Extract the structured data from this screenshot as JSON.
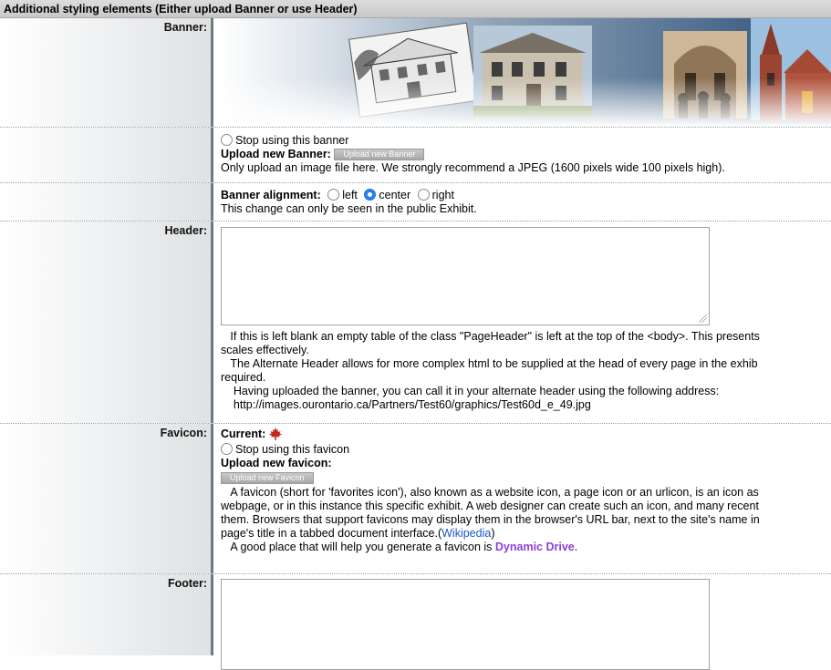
{
  "section_title": "Additional styling elements (Either upload Banner or use Header)",
  "banner": {
    "label": "Banner:",
    "stop_label": "Stop using this banner",
    "upload_label": "Upload new Banner:",
    "upload_button": "Upload new Banner",
    "upload_note": "Only upload an image file here. We strongly recommend a JPEG (1600 pixels wide 100 pixels high).",
    "alignment_label": "Banner alignment:",
    "align_options": [
      "left",
      "center",
      "right"
    ],
    "align_selected": "center",
    "alignment_note": "This change can only be seen in the public Exhibit."
  },
  "header": {
    "label": "Header:",
    "value": "",
    "help_1a": "If this is left blank an empty table of the class \"PageHeader\" is left at the top of the <body>. This presents",
    "help_1b": "scales effectively.",
    "help_2a": "The Alternate Header allows for more complex html to be supplied at the head of every page in the exhib",
    "help_2b": "required.",
    "help_3": "Having uploaded the banner, you can call it in your alternate header using the following address:",
    "help_url": "http://images.ourontario.ca/Partners/Test60/graphics/Test60d_e_49.jpg"
  },
  "favicon": {
    "label": "Favicon:",
    "current_label": "Current:",
    "stop_label": "Stop using this favicon",
    "upload_label": "Upload new favicon:",
    "upload_button": "Upload new Favicon",
    "desc_1": "A favicon (short for 'favorites icon'), also known as a website icon, a page icon or an urlicon, is an icon as",
    "desc_2": "webpage, or in this instance this specific exhibit. A web designer can create such an icon, and many recent",
    "desc_3": "them. Browsers that support favicons may display them in the browser's URL bar, next to the site's name in",
    "desc_4": "page's title in a tabbed document interface.(",
    "wikipedia_link": "Wikipedia",
    "desc_4_end": ")",
    "tip_prefix": "A good place that will help you generate a favicon is ",
    "tip_link": "Dynamic Drive",
    "tip_suffix": "."
  },
  "footer": {
    "label": "Footer:",
    "value": ""
  }
}
